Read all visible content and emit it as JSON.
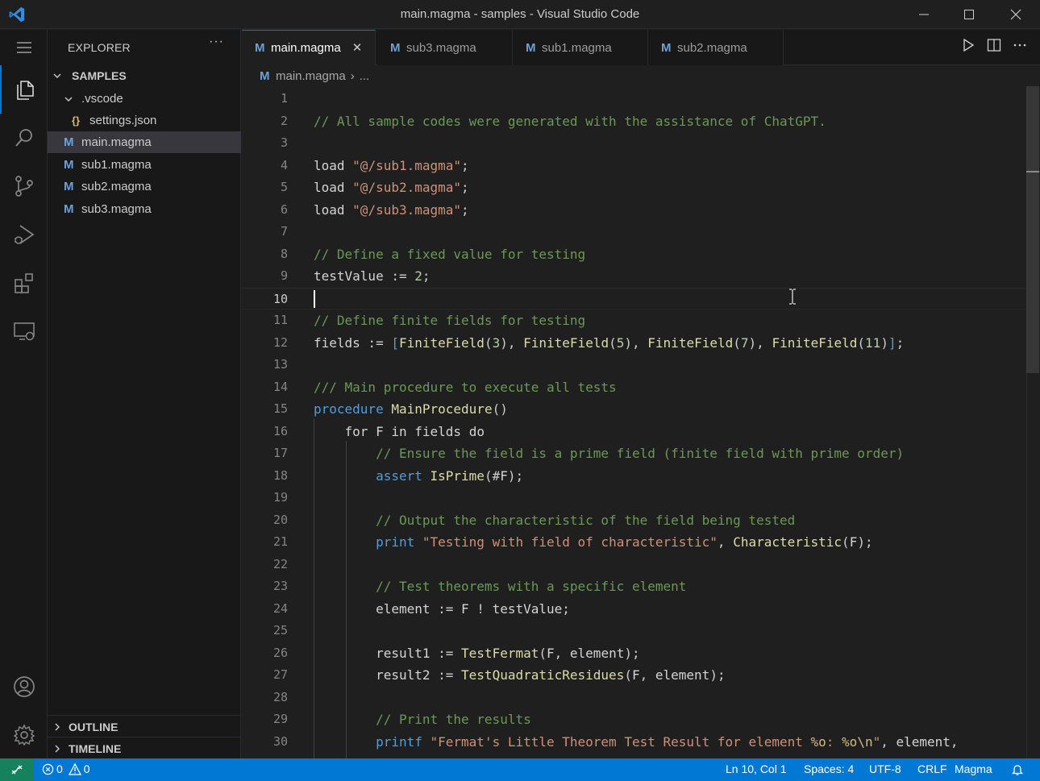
{
  "window": {
    "title": "main.magma - samples - Visual Studio Code"
  },
  "explorer": {
    "header": "EXPLORER",
    "more": "···",
    "folder": "SAMPLES",
    "items": [
      {
        "label": ".vscode",
        "kind": "folder"
      },
      {
        "label": "settings.json",
        "kind": "json",
        "icon": "{}"
      },
      {
        "label": "main.magma",
        "kind": "magma",
        "icon": "M"
      },
      {
        "label": "sub1.magma",
        "kind": "magma",
        "icon": "M"
      },
      {
        "label": "sub2.magma",
        "kind": "magma",
        "icon": "M"
      },
      {
        "label": "sub3.magma",
        "kind": "magma",
        "icon": "M"
      }
    ],
    "outline": "OUTLINE",
    "timeline": "TIMELINE"
  },
  "tabs": [
    {
      "label": "main.magma",
      "active": true,
      "close": "✕"
    },
    {
      "label": "sub3.magma",
      "active": false
    },
    {
      "label": "sub1.magma",
      "active": false
    },
    {
      "label": "sub2.magma",
      "active": false
    }
  ],
  "breadcrumb": {
    "file": "main.magma",
    "separator": "›",
    "rest": "..."
  },
  "editor": {
    "current_line": 10,
    "lines": [
      {
        "n": "1",
        "code": ""
      },
      {
        "n": "2",
        "code": "// All sample codes were generated with the assistance of ChatGPT."
      },
      {
        "n": "3",
        "code": ""
      },
      {
        "n": "4",
        "code": "load \"@/sub1.magma\";"
      },
      {
        "n": "5",
        "code": "load \"@/sub2.magma\";"
      },
      {
        "n": "6",
        "code": "load \"@/sub3.magma\";"
      },
      {
        "n": "7",
        "code": ""
      },
      {
        "n": "8",
        "code": "// Define a fixed value for testing"
      },
      {
        "n": "9",
        "code": "testValue := 2;"
      },
      {
        "n": "10",
        "code": ""
      },
      {
        "n": "11",
        "code": "// Define finite fields for testing"
      },
      {
        "n": "12",
        "code": "fields := [FiniteField(3), FiniteField(5), FiniteField(7), FiniteField(11)];"
      },
      {
        "n": "13",
        "code": ""
      },
      {
        "n": "14",
        "code": "/// Main procedure to execute all tests"
      },
      {
        "n": "15",
        "code": "procedure MainProcedure()"
      },
      {
        "n": "16",
        "code": "    for F in fields do"
      },
      {
        "n": "17",
        "code": "        // Ensure the field is a prime field (finite field with prime order)"
      },
      {
        "n": "18",
        "code": "        assert IsPrime(#F);"
      },
      {
        "n": "19",
        "code": ""
      },
      {
        "n": "20",
        "code": "        // Output the characteristic of the field being tested"
      },
      {
        "n": "21",
        "code": "        print \"Testing with field of characteristic\", Characteristic(F);"
      },
      {
        "n": "22",
        "code": ""
      },
      {
        "n": "23",
        "code": "        // Test theorems with a specific element"
      },
      {
        "n": "24",
        "code": "        element := F ! testValue;"
      },
      {
        "n": "25",
        "code": ""
      },
      {
        "n": "26",
        "code": "        result1 := TestFermat(F, element);"
      },
      {
        "n": "27",
        "code": "        result2 := TestQuadraticResidues(F, element);"
      },
      {
        "n": "28",
        "code": ""
      },
      {
        "n": "29",
        "code": "        // Print the results"
      },
      {
        "n": "30",
        "code": "        printf \"Fermat's Little Theorem Test Result for element %o: %o\\n\", element,"
      }
    ]
  },
  "status": {
    "errors": "0",
    "warnings": "0",
    "position": "Ln 10, Col 1",
    "spaces": "Spaces: 4",
    "encoding": "UTF-8",
    "eol": "CRLF",
    "language": "Magma"
  },
  "colors": {
    "accent": "#0078d4",
    "remote": "#16825d",
    "comment": "#6a9955",
    "string": "#ce9178",
    "keyword": "#569cd6",
    "function": "#dcdcaa"
  }
}
